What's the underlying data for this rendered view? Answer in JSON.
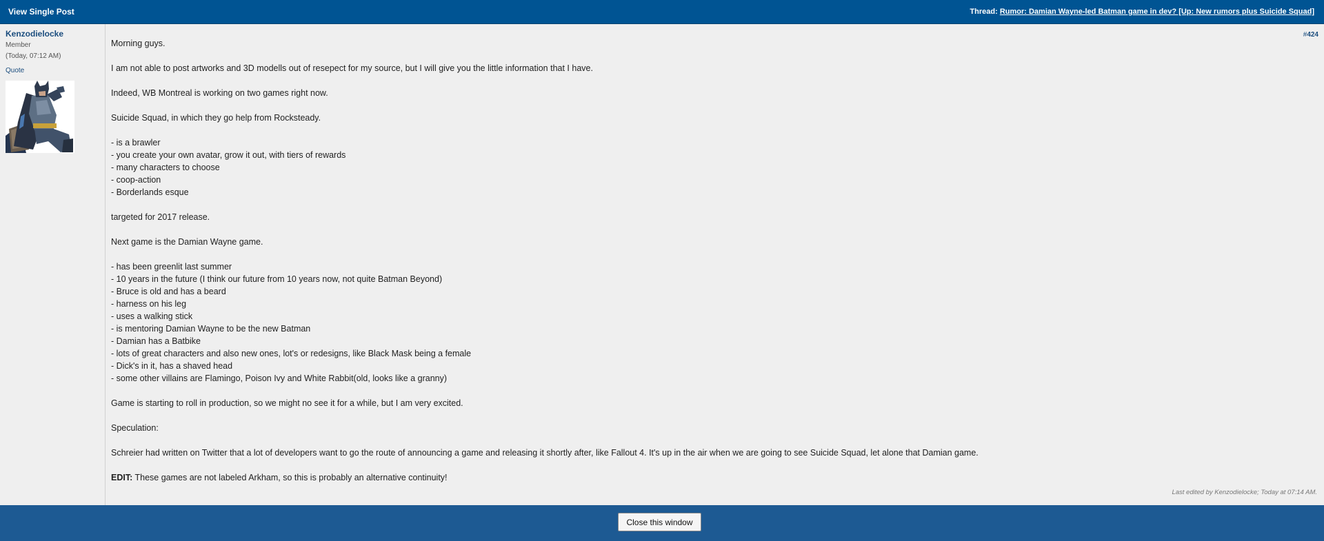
{
  "header": {
    "title": "View Single Post",
    "thread_label": "Thread:",
    "thread_link": "Rumor: Damian Wayne-led Batman game in dev? [Up: New rumors plus Suicide Squad]"
  },
  "user": {
    "name": "Kenzodielocke",
    "title": "Member",
    "time": "(Today, 07:12 AM)",
    "quote_label": "Quote"
  },
  "post": {
    "number_hash": "#",
    "number": "424",
    "lines": [
      "Morning guys.",
      "",
      "I am not able to post artworks and 3D modells out of resepect for my source, but I will give you the little information that I have.",
      "",
      "Indeed, WB Montreal is working on two games right now.",
      "",
      "Suicide Squad, in which they go help from Rocksteady.",
      "",
      "- is a brawler",
      "- you create your own avatar, grow it out, with tiers of rewards",
      "- many characters to choose",
      "- coop-action",
      "- Borderlands esque",
      "",
      "targeted for 2017 release.",
      "",
      "Next game is the Damian Wayne game.",
      "",
      "- has been greenlit last summer",
      "- 10 years in the future (I think our future from 10 years now, not quite Batman Beyond)",
      "- Bruce is old and has a beard",
      "- harness on his leg",
      "- uses a walking stick",
      "- is mentoring Damian Wayne to be the new Batman",
      "- Damian has a Batbike",
      "- lots of great characters and also new ones, lot's or redesigns, like Black Mask being a female",
      "- Dick's in it, has a shaved head",
      "- some other villains are Flamingo, Poison Ivy and White Rabbit(old, looks like a granny)",
      "",
      "Game is starting to roll in production, so we might no see it for a while, but I am very excited.",
      "",
      "Speculation:",
      "",
      "Schreier had written on Twitter that a lot of developers want to go the route of announcing a game and releasing it shortly after, like Fallout 4. It's up in the air when we are going to see Suicide Squad, let alone that Damian game.",
      ""
    ],
    "edit_label": "EDIT:",
    "edit_text": " These games are not labeled Arkham, so this is probably an alternative continuity!",
    "last_edited": "Last edited by Kenzodielocke; Today at 07:14 AM."
  },
  "footer": {
    "close_button": "Close this window"
  },
  "colors": {
    "header_bg": "#005493",
    "footer_bg": "#1d5a93",
    "post_bg": "#efefef",
    "link": "#1b4d7e"
  },
  "icons": {
    "avatar": "batman-avatar"
  }
}
